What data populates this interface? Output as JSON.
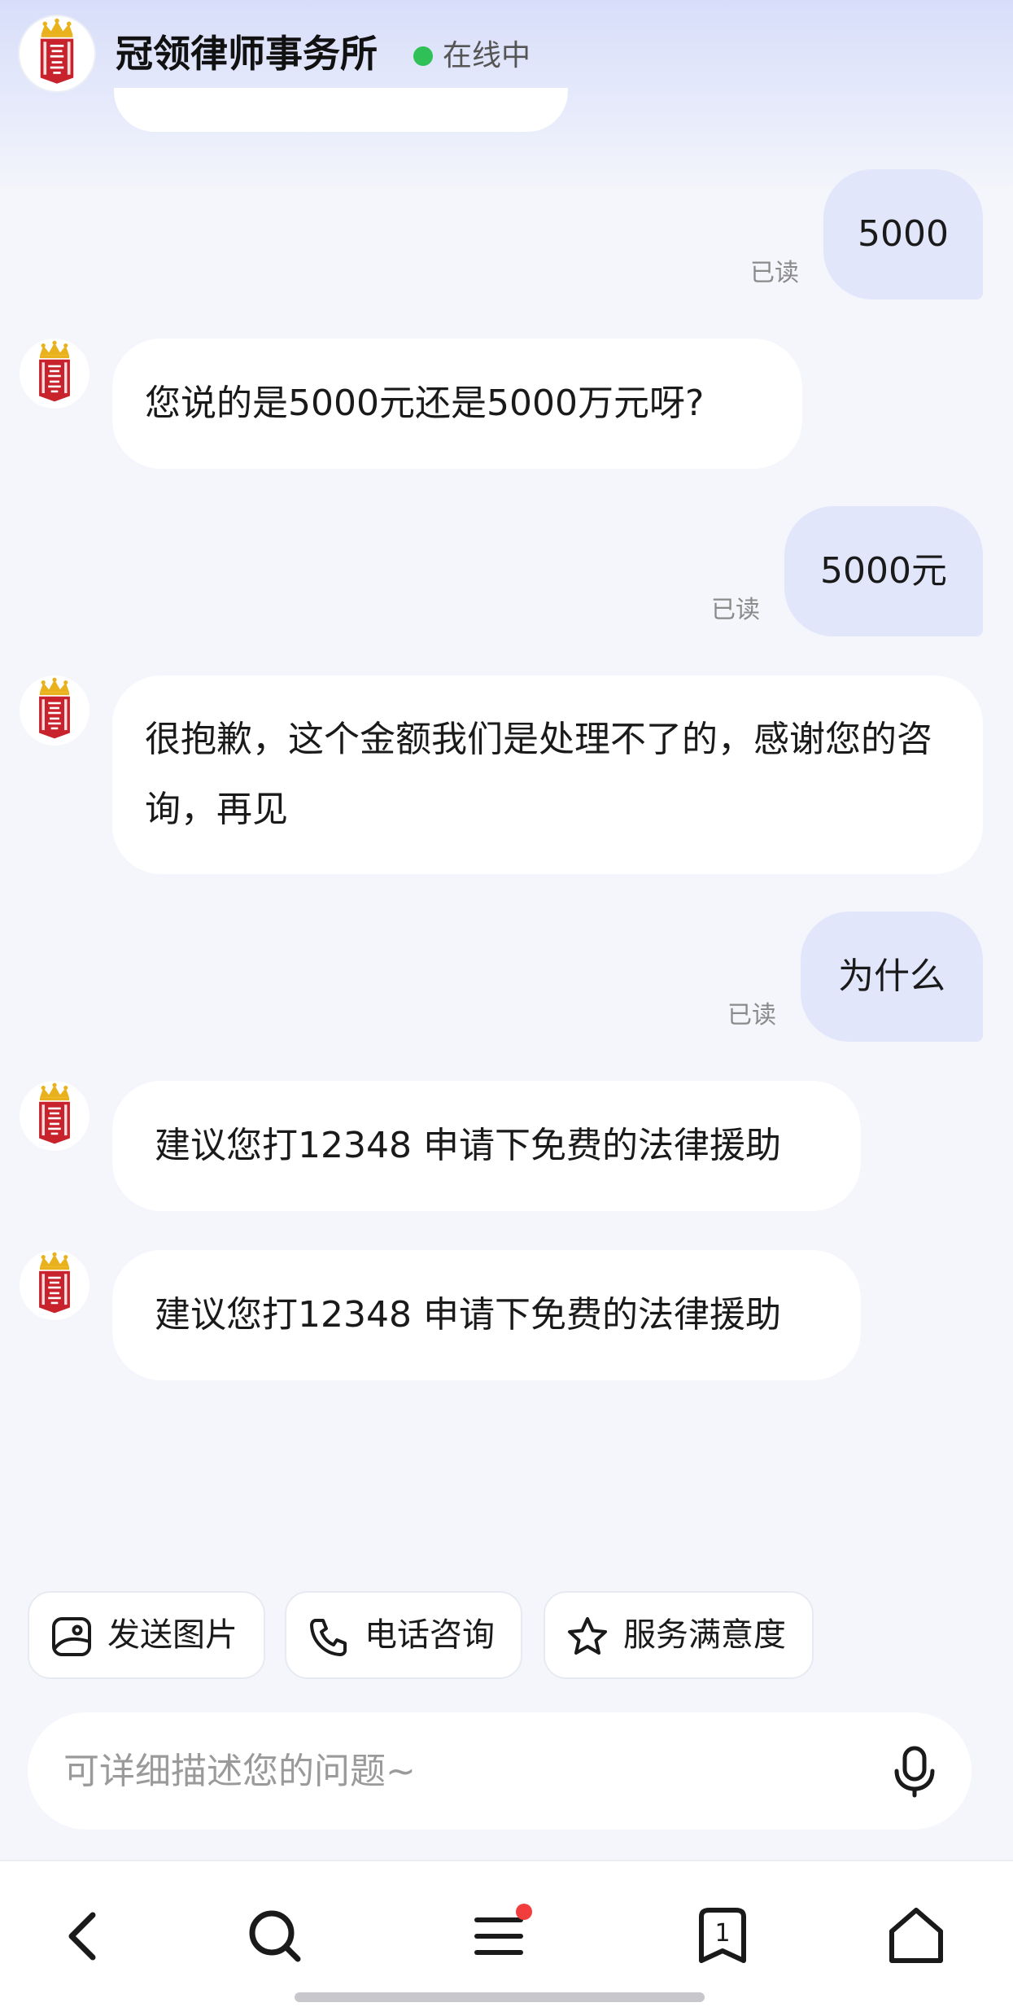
{
  "header": {
    "title": "冠领律师事务所",
    "status": "在线中",
    "status_color": "#2fc157",
    "logo_icon": "crown-shield-logo"
  },
  "messages": [
    {
      "from": "user",
      "text": "5000",
      "read_label": "已读"
    },
    {
      "from": "agent",
      "text": "您说的是5000元还是5000万元呀?"
    },
    {
      "from": "user",
      "text": "5000元",
      "read_label": "已读"
    },
    {
      "from": "agent",
      "text": "很抱歉，这个金额我们是处理不了的，感谢您的咨询，再见"
    },
    {
      "from": "user",
      "text": "为什么",
      "read_label": "已读"
    },
    {
      "from": "agent",
      "text": "建议您打12348 申请下免费的法律援助"
    },
    {
      "from": "agent",
      "text": "建议您打12348 申请下免费的法律援助"
    }
  ],
  "quick_actions": [
    {
      "label": "发送图片",
      "icon": "image-icon"
    },
    {
      "label": "电话咨询",
      "icon": "phone-icon"
    },
    {
      "label": "服务满意度",
      "icon": "star-icon"
    }
  ],
  "composer": {
    "placeholder": "可详细描述您的问题~",
    "value": "",
    "mic_icon": "microphone-icon"
  },
  "nav": {
    "items": [
      "back-icon",
      "search-icon",
      "menu-icon",
      "bookmark-icon",
      "home-icon"
    ],
    "bookmark_count": "1",
    "badge_color": "#f23d3d"
  },
  "colors": {
    "outgoing_bubble": "#e1e6fb",
    "incoming_bubble": "#ffffff",
    "logo_red": "#c8222c",
    "logo_gold": "#e9b21c"
  }
}
